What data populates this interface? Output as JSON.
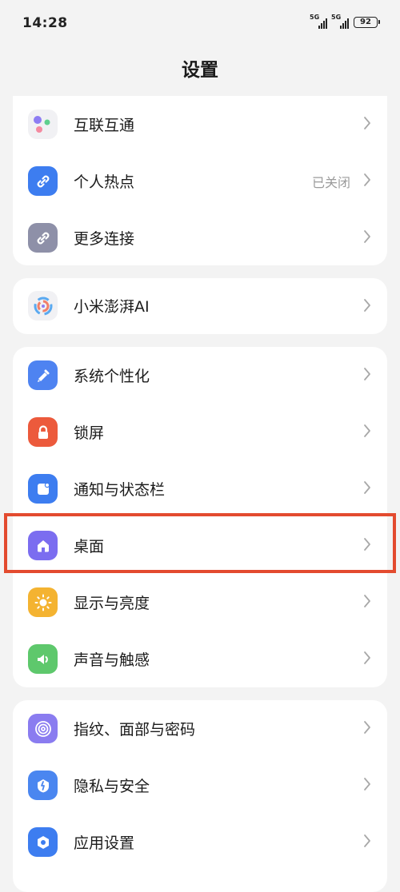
{
  "status_bar": {
    "time": "14:28",
    "network1": "5G",
    "network2": "5G",
    "battery": "92"
  },
  "header": {
    "title": "设置"
  },
  "groups": [
    {
      "items": [
        {
          "label": "互联互通",
          "icon": "interconnect-icon"
        },
        {
          "label": "个人热点",
          "icon": "hotspot-link-icon",
          "value": "已关闭"
        },
        {
          "label": "更多连接",
          "icon": "link-icon"
        }
      ]
    },
    {
      "items": [
        {
          "label": "小米澎湃AI",
          "icon": "ai-swirl-icon"
        }
      ]
    },
    {
      "items": [
        {
          "label": "系统个性化",
          "icon": "brush-icon",
          "color": "#4e83f1"
        },
        {
          "label": "锁屏",
          "icon": "lock-icon",
          "color": "#ec5a3c"
        },
        {
          "label": "通知与状态栏",
          "icon": "notification-icon",
          "color": "#3d7df0"
        },
        {
          "label": "桌面",
          "icon": "home-icon",
          "color": "#7b6df0"
        },
        {
          "label": "显示与亮度",
          "icon": "sun-icon",
          "color": "#f4b331"
        },
        {
          "label": "声音与触感",
          "icon": "speaker-icon",
          "color": "#5ec86c"
        }
      ]
    },
    {
      "items": [
        {
          "label": "指纹、面部与密码",
          "icon": "fingerprint-icon",
          "color": "#8a7cf0"
        },
        {
          "label": "隐私与安全",
          "icon": "privacy-shield-icon",
          "color": "#4a86f0"
        },
        {
          "label": "应用设置",
          "icon": "app-settings-icon",
          "color": "#3d7df0"
        }
      ]
    }
  ],
  "highlight": {
    "target": "桌面",
    "color": "#e34b2f"
  }
}
